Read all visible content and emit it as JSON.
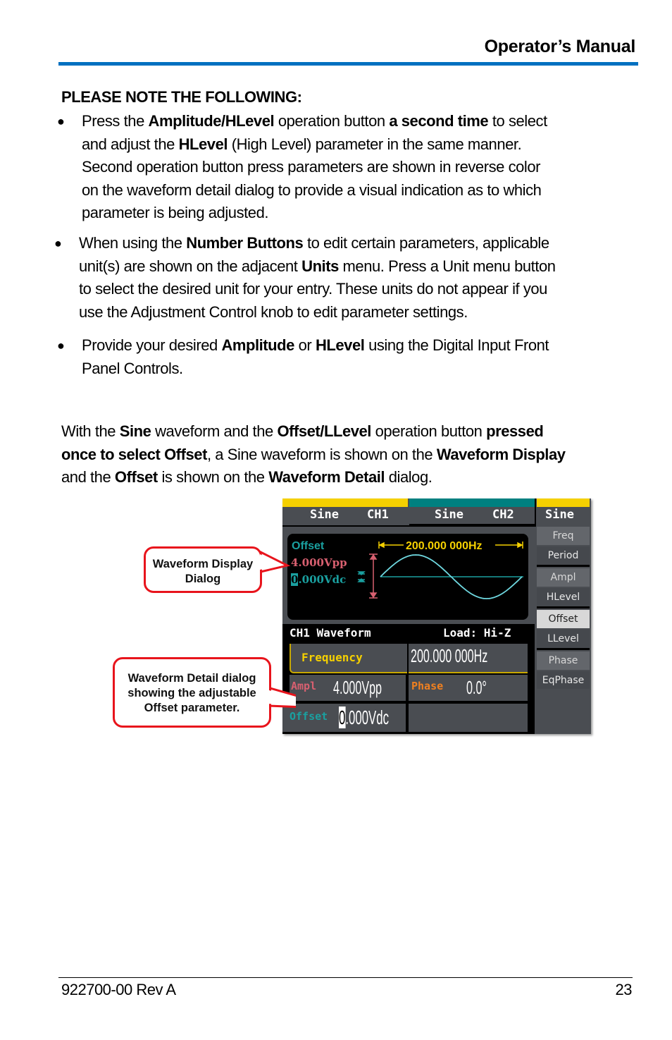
{
  "header": {
    "title": "Operator’s Manual",
    "rule_color": "#0070c0"
  },
  "notes": {
    "title": "PLEASE NOTE THE FOLLOWING",
    "title_suffix": ":",
    "bullets": [
      {
        "lines": [
          [
            {
              "t": "Press the "
            },
            {
              "t": "Amplitude/HLevel",
              "b": true
            },
            {
              "t": " operation button "
            },
            {
              "t": "a second time",
              "b": true
            },
            {
              "t": " to select"
            }
          ],
          [
            {
              "t": "and adjust the "
            },
            {
              "t": "HLevel",
              "b": true
            },
            {
              "t": " (High Level) parameter in the same manner."
            }
          ],
          [
            {
              "t": "Second operation button press parameters are shown in reverse color"
            }
          ],
          [
            {
              "t": "on the waveform detail dialog to provide a visual indication as to which"
            }
          ],
          [
            {
              "t": "parameter is being adjusted."
            }
          ]
        ]
      },
      {
        "lines": [
          [
            {
              "t": "When using the "
            },
            {
              "t": "Number Buttons",
              "b": true
            },
            {
              "t": " to edit certain parameters, applicable"
            }
          ],
          [
            {
              "t": "unit(s) are shown on the adjacent "
            },
            {
              "t": "Units",
              "b": true
            },
            {
              "t": " menu. Press a Unit menu button"
            }
          ],
          [
            {
              "t": "to select the desired unit for your entry. These units do not appear if you"
            }
          ],
          [
            {
              "t": "use the Adjustment Control knob to edit parameter settings."
            }
          ]
        ]
      },
      {
        "lines": [
          [
            {
              "t": "Provide your desired "
            },
            {
              "t": "Amplitude",
              "b": true
            },
            {
              "t": " or "
            },
            {
              "t": "HLevel",
              "b": true
            },
            {
              "t": " using the Digital Input Front"
            }
          ],
          [
            {
              "t": "Panel Controls."
            }
          ]
        ]
      }
    ]
  },
  "paragraph": {
    "lines": [
      [
        {
          "t": "With the "
        },
        {
          "t": "Sine",
          "b": true
        },
        {
          "t": " waveform and the "
        },
        {
          "t": "Offset/LLevel",
          "b": true
        },
        {
          "t": " operation button "
        },
        {
          "t": "pressed",
          "b": true
        }
      ],
      [
        {
          "t": "once to select Offset",
          "b": true
        },
        {
          "t": ", a Sine waveform is shown on the "
        },
        {
          "t": "Waveform Display",
          "b": true
        }
      ],
      [
        {
          "t": "and the "
        },
        {
          "t": "Offset",
          "b": true
        },
        {
          "t": " is shown on the "
        },
        {
          "t": "Waveform Detail",
          "b": true
        },
        {
          "t": " dialog."
        }
      ]
    ]
  },
  "device": {
    "tabs": [
      {
        "wave": "Sine",
        "channel": "CH1",
        "color": "#f5d000"
      },
      {
        "wave": "Sine",
        "channel": "CH2",
        "color": "#008080"
      },
      {
        "wave": "Sine",
        "color": "#f5d000"
      }
    ],
    "display": {
      "param_label": "Offset",
      "amplitude": "4.000Vpp",
      "offset_cursor": "0",
      "offset_rest": ".000Vdc",
      "frequency": "200.000 000Hz"
    },
    "detail": {
      "title": "CH1 Waveform",
      "load": "Load: Hi-Z",
      "frequency_label": "Frequency",
      "frequency_value": "200.000 000Hz",
      "ampl_label": "Ampl",
      "ampl_value": "4.000Vpp",
      "phase_label": "Phase",
      "phase_value": "0.0°",
      "offset_label": "Offset",
      "offset_cursor": "0",
      "offset_rest": ".000Vdc"
    },
    "menu": [
      {
        "top": "Freq",
        "bottom": "Period"
      },
      {
        "top": "Ampl",
        "bottom": "HLevel"
      },
      {
        "top": "Offset",
        "bottom": "LLevel",
        "selected": "top"
      },
      {
        "top": "Phase",
        "bottom": "EqPhase"
      }
    ],
    "colors": {
      "offset": "#1aa0a0",
      "ampl": "#d86070",
      "phase": "#f08020",
      "freq": "#f5d000",
      "wave": "#6fd8e0"
    }
  },
  "callouts": {
    "display": [
      "Waveform Display",
      "Dialog"
    ],
    "detail": [
      "Waveform Detail dialog",
      "showing the adjustable",
      "Offset parameter."
    ]
  },
  "footer": {
    "doc_id": "922700-00 Rev A",
    "page": "23"
  }
}
